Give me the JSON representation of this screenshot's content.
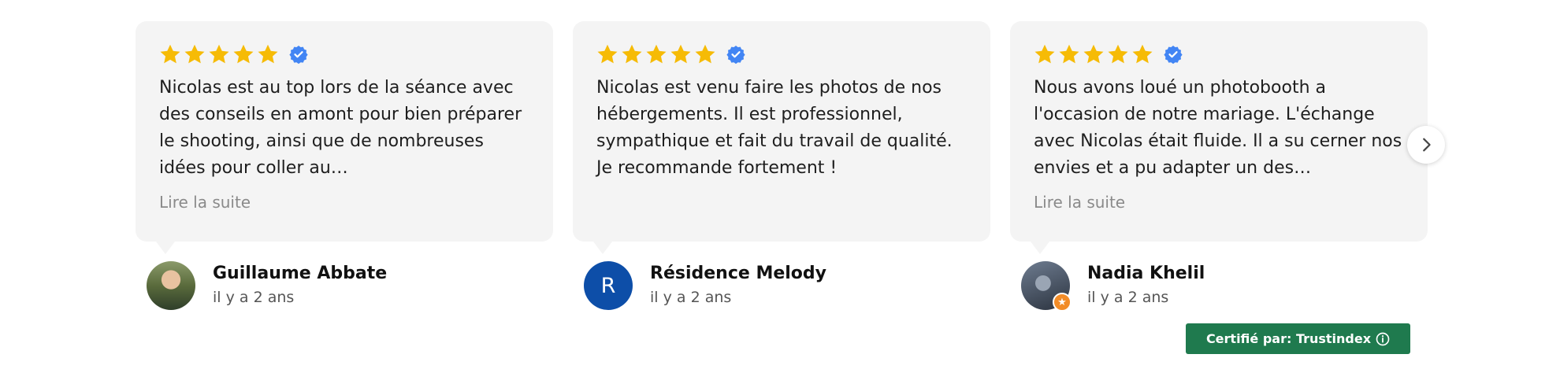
{
  "colors": {
    "star": "#f6bb06",
    "verified": "#4285f4",
    "card_bg": "#f4f4f4",
    "certified_bg": "#1f7a4e",
    "avatar_r": "#0d4ea8"
  },
  "rating": {
    "stars": 5,
    "max": 5
  },
  "reviews": [
    {
      "text": "Nicolas est au top lors de la séance avec des conseils en amont pour bien préparer le shooting, ainsi que de nombreuses idées pour coller au…",
      "more_label": "Lire la suite",
      "author": "Guillaume Abbate",
      "date": "il y a 2 ans",
      "avatar": "photo"
    },
    {
      "text": "Nicolas est venu faire les photos de nos hébergements. Il est professionnel, sympathique et fait du travail de qualité. Je recommande fortement !",
      "more_label": "",
      "author": "Résidence Melody",
      "date": "il y a 2 ans",
      "avatar_letter": "R"
    },
    {
      "text": "Nous avons loué un photobooth a l'occasion de notre mariage. L'échange avec Nicolas était fluide. Il a su cerner nos envies et a pu adapter un des…",
      "more_label": "Lire la suite",
      "author": "Nadia Khelil",
      "date": "il y a 2 ans",
      "avatar": "photo",
      "badge": "★"
    }
  ],
  "icons": {
    "next": "chevron-right-icon",
    "verified": "verified-check-icon",
    "star": "star-icon",
    "info": "info-circle-icon"
  },
  "footer": {
    "certified_label": "Certifié par: Trustindex"
  }
}
